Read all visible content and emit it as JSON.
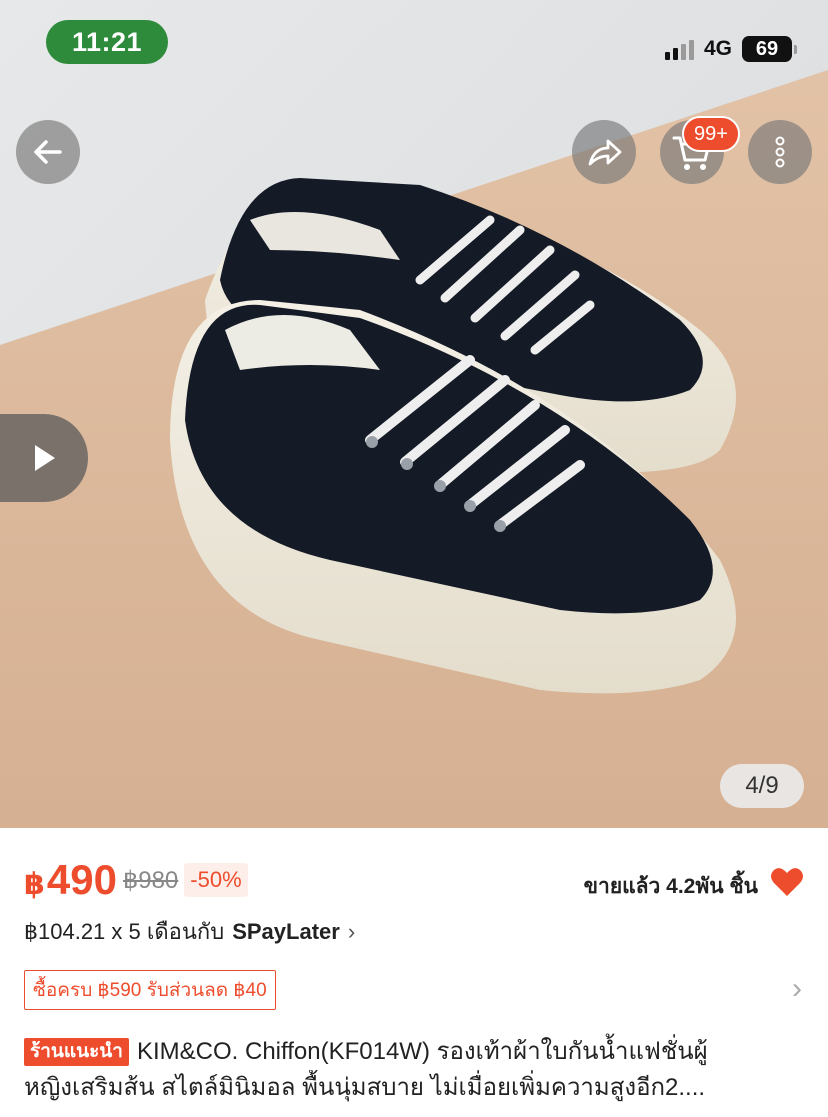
{
  "status_bar": {
    "time": "11:21",
    "network": "4G",
    "battery": "69"
  },
  "hero": {
    "image_counter": "4/9",
    "cart_badge": "99+",
    "icons": {
      "back": "back-arrow-icon",
      "share": "share-icon",
      "cart": "cart-icon",
      "more": "more-icon",
      "play": "play-icon"
    }
  },
  "product": {
    "currency": "฿",
    "price": "490",
    "original_price": "฿980",
    "discount": "-50%",
    "sold": "ขายแล้ว 4.2พัน ชิ้น",
    "installment": "฿104.21 x 5 เดือนกับ",
    "installment_provider": "SPayLater",
    "voucher": "ซื้อครบ ฿590 รับส่วนลด ฿40",
    "shop_tag": "ร้านแนะนำ",
    "title_line1": "KIM&CO. Chiffon(KF014W) รองเท้าผ้าใบกันน้ำแฟชั่นผู้",
    "title_line2": "หญิงเสริมส้น สไตล์มินิมอล พื้นนุ่มสบาย ไม่เมื่อยเพิ่มความสูงอีก2...."
  },
  "colors": {
    "accent": "#ee4d2d",
    "status_pill": "#2e8b3c"
  }
}
